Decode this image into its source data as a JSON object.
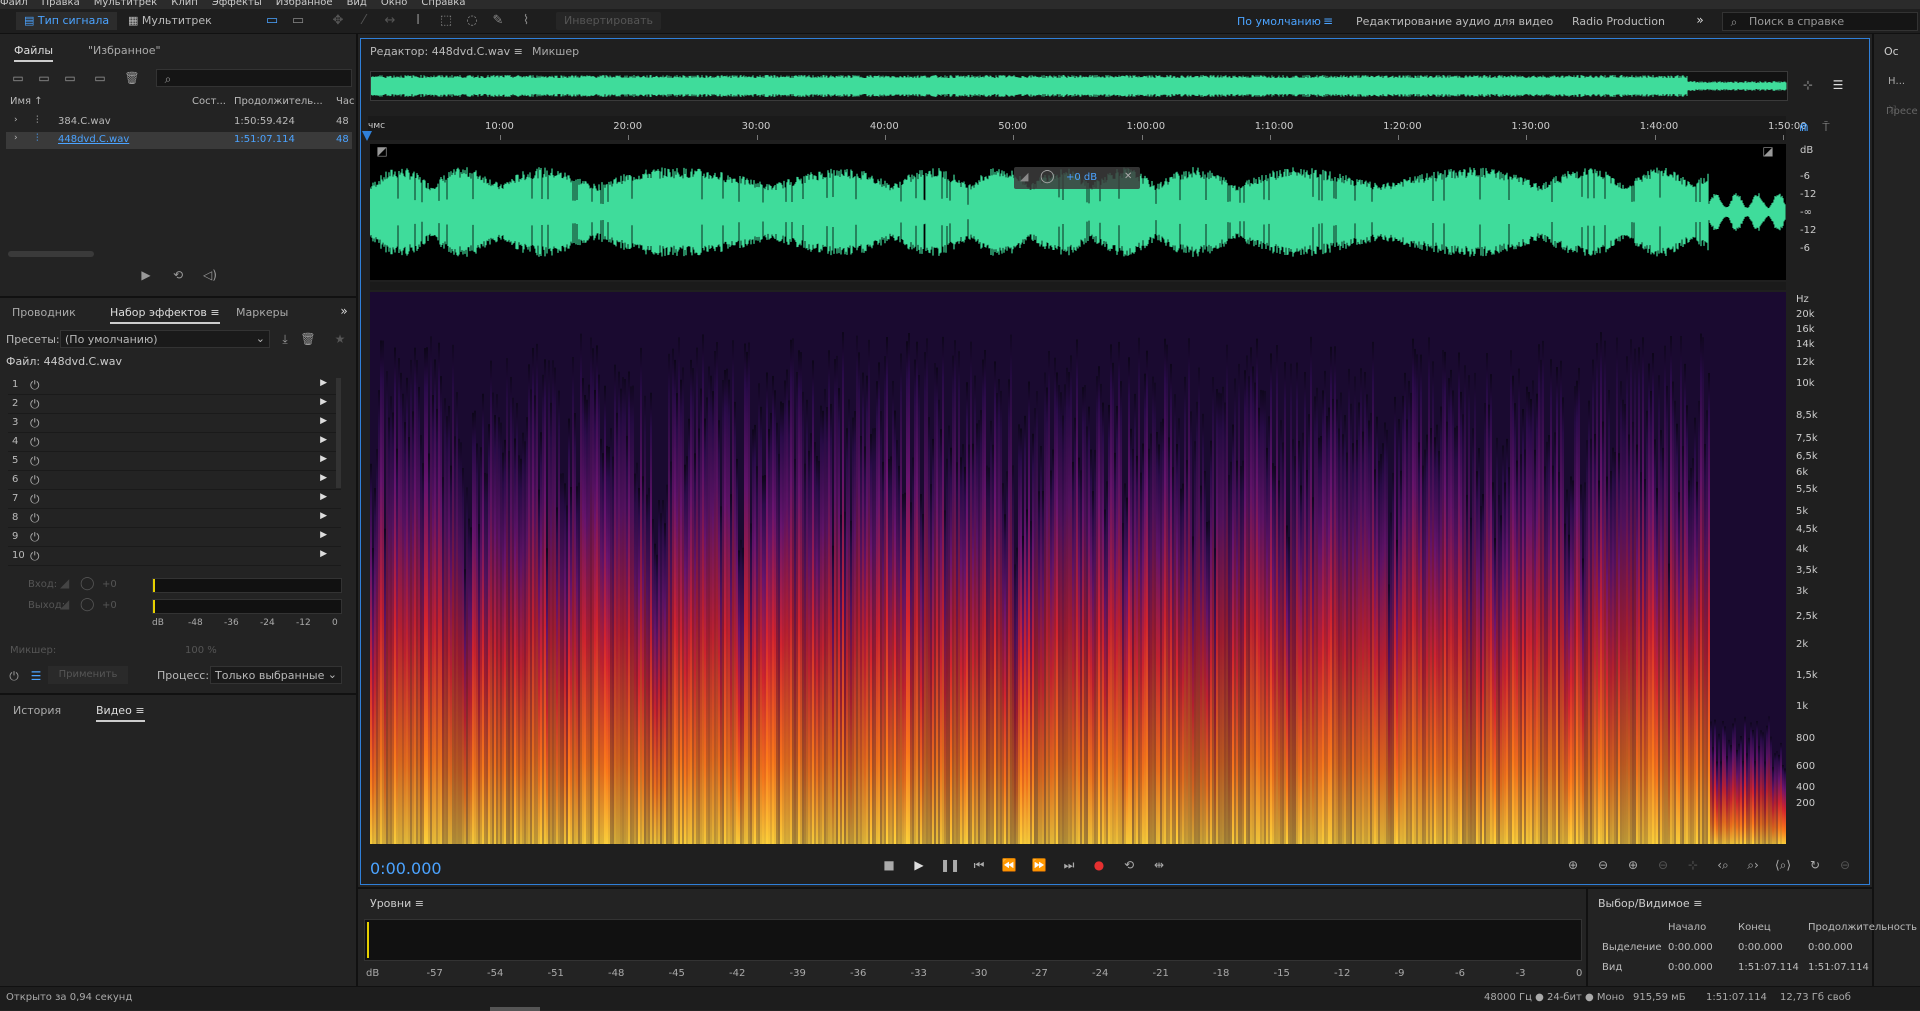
{
  "menu": [
    "Файл",
    "Правка",
    "Мультитрек",
    "Клип",
    "Эффекты",
    "Избранное",
    "Вид",
    "Окно",
    "Справка"
  ],
  "toolbar": {
    "waveform_label": "Тип сигнала",
    "multitrack_label": "Мультитрек",
    "invert_label": "Инвертировать",
    "workspaces": [
      "По умолчанию",
      "Редактирование аудио для видео",
      "Radio Production"
    ],
    "search_placeholder": "Поиск в справке"
  },
  "files_panel": {
    "tabs": [
      "Файлы",
      "\"Избранное\""
    ],
    "columns": [
      "Имя",
      "Сост...",
      "Продолжитель...",
      "Час"
    ],
    "rows": [
      {
        "name": "384.C.wav",
        "duration": "1:50:59.424",
        "rate": "48"
      },
      {
        "name": "448dvd.C.wav",
        "duration": "1:51:07.114",
        "rate": "48"
      }
    ]
  },
  "effects_panel": {
    "tabs": [
      "Проводник",
      "Набор эффектов",
      "Маркеры"
    ],
    "presets_label": "Пресеты:",
    "presets_value": "(По умолчанию)",
    "file_label": "Файл: 448dvd.C.wav",
    "slots": [
      "1",
      "2",
      "3",
      "4",
      "5",
      "6",
      "7",
      "8",
      "9",
      "10"
    ],
    "input_label": "Вход:",
    "output_label": "Выход:",
    "gain_in": "+0",
    "gain_out": "+0",
    "meter_ticks": [
      "dB",
      "-48",
      "-36",
      "-24",
      "-12",
      "0"
    ],
    "mixer_label": "Микшер:",
    "mixer_value": "100 %",
    "apply_label": "Применить",
    "process_label": "Процесс:",
    "process_value": "Только выбранные"
  },
  "lower_left_tabs": [
    "История",
    "Видео"
  ],
  "editor": {
    "tab_label": "Редактор: 448dvd.C.wav",
    "mixer_tab": "Микшер",
    "ruler_unit": "чмс",
    "ruler_ticks": [
      "10:00",
      "20:00",
      "30:00",
      "40:00",
      "50:00",
      "1:00:00",
      "1:10:00",
      "1:20:00",
      "1:30:00",
      "1:40:00",
      "1:50:00"
    ],
    "hud_gain": "+0 dB",
    "db_scale": [
      "dB",
      "-6",
      "-12",
      "-∞",
      "-12",
      "-6"
    ],
    "hz_scale": [
      "Hz",
      "20k",
      "16k",
      "14k",
      "12k",
      "10k",
      "8,5k",
      "7,5k",
      "6,5k",
      "6k",
      "5,5k",
      "5k",
      "4,5k",
      "4k",
      "3,5k",
      "3k",
      "2,5k",
      "2k",
      "1,5k",
      "1k",
      "800",
      "600",
      "400",
      "200"
    ],
    "current_time": "0:00.000"
  },
  "levels": {
    "title": "Уровни",
    "ticks": [
      "dB",
      "-57",
      "-54",
      "-51",
      "-48",
      "-45",
      "-42",
      "-39",
      "-36",
      "-33",
      "-30",
      "-27",
      "-24",
      "-21",
      "-18",
      "-15",
      "-12",
      "-9",
      "-6",
      "-3",
      "0"
    ]
  },
  "selection": {
    "title": "Выбор/Видимое",
    "headers": [
      "Начало",
      "Конец",
      "Продолжительность"
    ],
    "rows": [
      {
        "label": "Выделение",
        "start": "0:00.000",
        "end": "0:00.000",
        "duration": "0:00.000"
      },
      {
        "label": "Вид",
        "start": "0:00.000",
        "end": "1:51:07.114",
        "duration": "1:51:07.114"
      }
    ]
  },
  "right_strip": {
    "label_top": "Ос",
    "label_mid": "Н...",
    "label_low": "Пресе"
  },
  "status": {
    "left": "Открыто за 0,94 секунд",
    "format": "48000 Гц ● 24-бит ● Моно",
    "size": "915,59 мБ",
    "duration": "1:51:07.114",
    "free": "12,73 Гб своб"
  },
  "colors": {
    "accent": "#2f7fd8",
    "waveform": "#3fdc9b",
    "selection_text": "#4ba3ff"
  }
}
